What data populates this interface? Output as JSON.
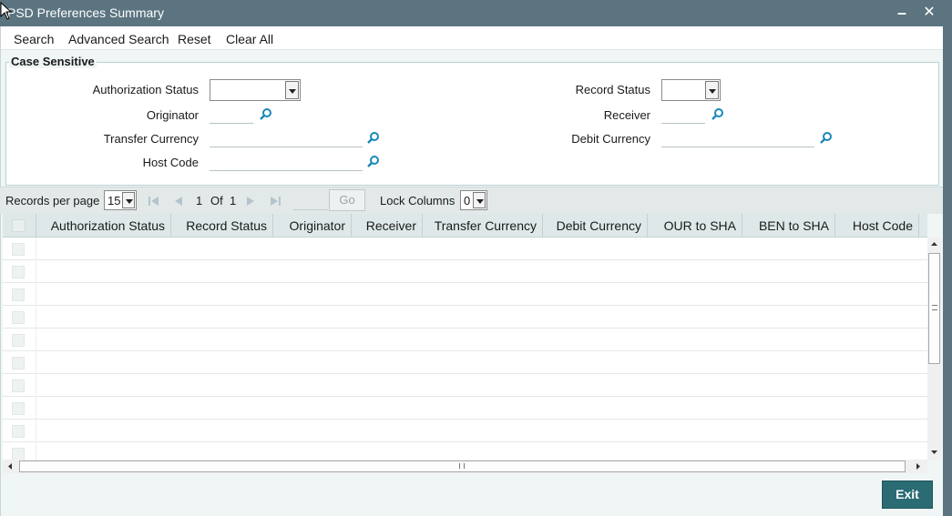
{
  "window": {
    "title": "PSD Preferences Summary",
    "minimize_glyph": "–",
    "close_glyph": "✕"
  },
  "menu": {
    "search": "Search",
    "advanced_search": "Advanced Search",
    "reset": "Reset",
    "clear_all": "Clear All"
  },
  "criteria": {
    "section_title": "Case Sensitive",
    "authorization_status_label": "Authorization Status",
    "authorization_status_value": "",
    "record_status_label": "Record Status",
    "record_status_value": "",
    "originator_label": "Originator",
    "originator_value": "",
    "receiver_label": "Receiver",
    "receiver_value": "",
    "transfer_currency_label": "Transfer Currency",
    "transfer_currency_value": "",
    "debit_currency_label": "Debit Currency",
    "debit_currency_value": "",
    "host_code_label": "Host Code",
    "host_code_value": ""
  },
  "pager": {
    "records_per_page_label": "Records per page",
    "records_per_page_value": "15",
    "current_page": "1",
    "of_label": "Of",
    "total_pages": "1",
    "go_label": "Go",
    "lock_columns_label": "Lock Columns",
    "lock_columns_value": "0"
  },
  "grid": {
    "columns": [
      "Authorization Status",
      "Record Status",
      "Originator",
      "Receiver",
      "Transfer Currency",
      "Debit Currency",
      "OUR to SHA",
      "BEN to SHA",
      "Host Code"
    ],
    "row_count": 10
  },
  "footer": {
    "exit_label": "Exit"
  },
  "colors": {
    "titlebar": "#5b7480",
    "accent_button": "#2a6b74",
    "lookup_icon": "#1a88b8"
  },
  "icons": {
    "lookup": "magnifier-icon",
    "first_page": "first-page-icon",
    "prev_page": "previous-page-icon",
    "next_page": "next-page-icon",
    "last_page": "last-page-icon"
  }
}
